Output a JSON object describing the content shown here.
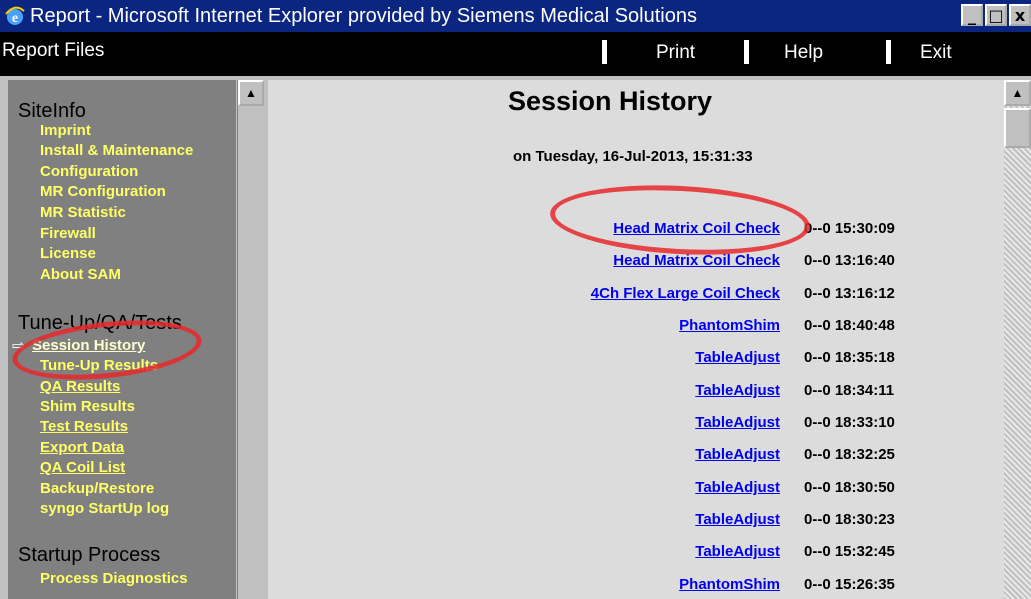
{
  "window": {
    "title": "Report - Microsoft Internet Explorer provided by Siemens Medical Solutions",
    "buttons": [
      "_",
      "□",
      "x"
    ]
  },
  "menubar": {
    "left_label": "Report Files",
    "items": [
      "Print",
      "Help",
      "Exit"
    ]
  },
  "sidebar": {
    "sections": [
      {
        "title": "SiteInfo",
        "items": [
          "Imprint",
          "Install & Maintenance",
          "Configuration",
          "MR Configuration",
          "MR Statistic",
          "Firewall",
          "License",
          "About SAM"
        ]
      },
      {
        "title": "Tune-Up/QA/Tests",
        "items": [
          "Session History",
          "Tune-Up Results",
          "QA Results",
          "Shim Results",
          "Test Results",
          "Export Data",
          "QA Coil List",
          "Backup/Restore",
          "syngo StartUp log"
        ]
      },
      {
        "title": "Startup Process",
        "items": [
          "Process Diagnostics"
        ]
      }
    ],
    "active_item": "Session History"
  },
  "main": {
    "title": "Session History",
    "date": "on Tuesday, 16-Jul-2013, 15:31:33",
    "rows": [
      {
        "name": "Head Matrix Coil Check",
        "time": "0--0 15:30:09"
      },
      {
        "name": "Head Matrix Coil Check",
        "time": "0--0 13:16:40"
      },
      {
        "name": "4Ch Flex Large Coil Check",
        "time": "0--0 13:16:12"
      },
      {
        "name": "PhantomShim",
        "time": "0--0 18:40:48"
      },
      {
        "name": "TableAdjust",
        "time": "0--0 18:35:18"
      },
      {
        "name": "TableAdjust",
        "time": "0--0 18:34:11"
      },
      {
        "name": "TableAdjust",
        "time": "0--0 18:33:10"
      },
      {
        "name": "TableAdjust",
        "time": "0--0 18:32:25"
      },
      {
        "name": "TableAdjust",
        "time": "0--0 18:30:50"
      },
      {
        "name": "TableAdjust",
        "time": "0--0 18:30:23"
      },
      {
        "name": "TableAdjust",
        "time": "0--0 15:32:45"
      },
      {
        "name": "PhantomShim",
        "time": "0--0 15:26:35"
      }
    ]
  },
  "colors": {
    "titlebar": "#0a2680",
    "sidebar_bg": "#808080",
    "sidebar_link": "#ffff66",
    "link": "#0000ee",
    "annotation": "#e8282c"
  }
}
